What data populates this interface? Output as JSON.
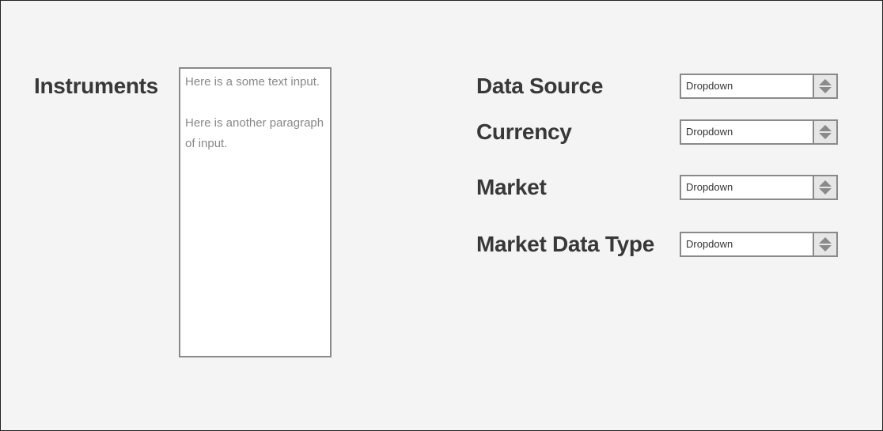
{
  "instruments": {
    "label": "Instruments",
    "text_paragraphs": [
      "Here is a some text input.",
      "Here is another paragraph of input."
    ]
  },
  "fields": [
    {
      "label": "Data Source",
      "value": "Dropdown"
    },
    {
      "label": "Currency",
      "value": "Dropdown"
    },
    {
      "label": "Market",
      "value": "Dropdown"
    },
    {
      "label": "Market Data Type",
      "value": "Dropdown"
    }
  ]
}
